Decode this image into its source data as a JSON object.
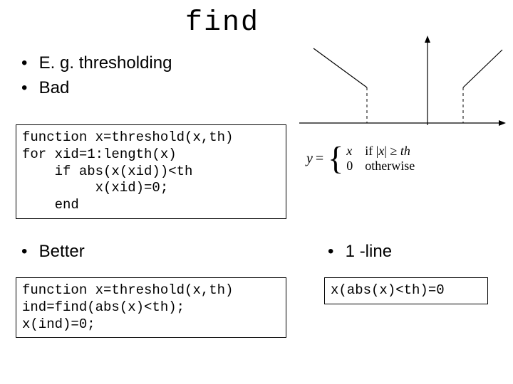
{
  "title": "find",
  "bullets": {
    "eg": "E. g. thresholding",
    "bad": "Bad",
    "better": "Better",
    "oneline": "1 -line"
  },
  "code": {
    "bad": "function x=threshold(x,th)\nfor xid=1:length(x)\n    if abs(x(xid))<th\n         x(xid)=0;\n    end",
    "better": "function x=threshold(x,th)\nind=find(abs(x)<th);\nx(ind)=0;",
    "oneline": "x(abs(x)<th)=0"
  },
  "equation": {
    "lhs_var": "y",
    "eq_sign": "=",
    "case1_val": "x",
    "case1_cond_prefix": "if |",
    "case1_cond_var": "x",
    "case1_cond_mid": "| ≥ ",
    "case1_cond_th": "th",
    "case2_val": "0",
    "case2_cond": "otherwise"
  },
  "chart_data": {
    "type": "line",
    "title": "",
    "xlabel": "",
    "ylabel": "",
    "xlim": [
      -3,
      3
    ],
    "ylim": [
      0,
      2
    ],
    "description": "Piecewise: y = x for |x| >= th (plotted as outward-sloping lines), y = 0 (dashed) for |x| < th",
    "series": [
      {
        "name": "left-branch",
        "x": [
          -3,
          -1.3
        ],
        "y": [
          2,
          0.2
        ],
        "style": "solid"
      },
      {
        "name": "left-dashed",
        "x": [
          -1.3,
          -1.3
        ],
        "y": [
          0.2,
          0
        ],
        "style": "dashed"
      },
      {
        "name": "right-branch",
        "x": [
          1.3,
          3
        ],
        "y": [
          0.2,
          2
        ],
        "style": "solid"
      },
      {
        "name": "right-dashed",
        "x": [
          1.3,
          1.3
        ],
        "y": [
          0.2,
          0
        ],
        "style": "dashed"
      }
    ],
    "axes": {
      "x_axis": true,
      "y_axis": true
    }
  }
}
